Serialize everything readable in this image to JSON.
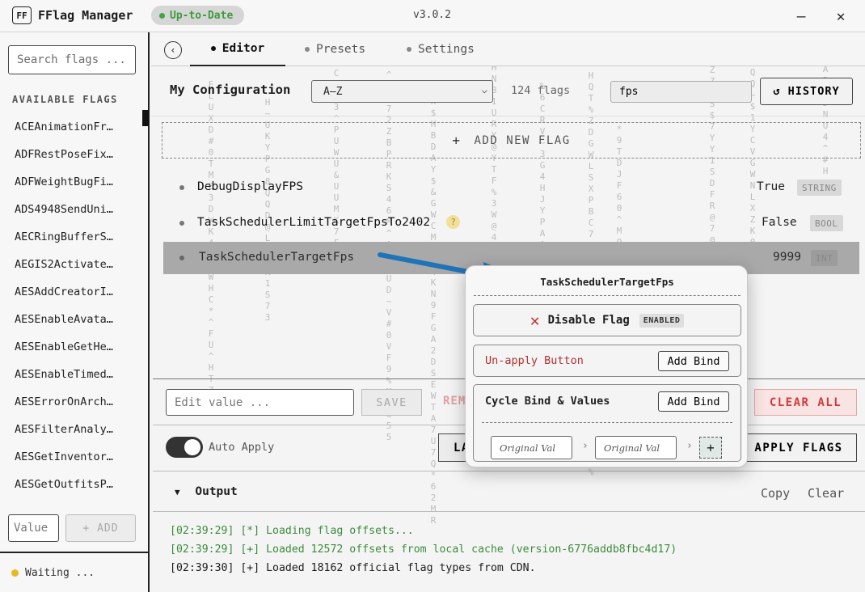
{
  "app": {
    "logo": "FF",
    "title": "FFlag Manager",
    "status": "Up-to-Date",
    "version": "v3.0.2",
    "minimize": "—",
    "close": "✕"
  },
  "sidebar": {
    "search_placeholder": "Search flags ...",
    "heading": "AVAILABLE FLAGS",
    "items": [
      "ACEAnimationFr…",
      "ADFRestPoseFix…",
      "ADFWeightBugFi…",
      "ADS4948SendUni…",
      "AECRingBufferS…",
      "AEGIS2Activate…",
      "AESAddCreatorI…",
      "AESEnableAvata…",
      "AESEnableGetHe…",
      "AESEnableTimed…",
      "AESErrorOnArch…",
      "AESFilterAnaly…",
      "AESGetInventor…",
      "AESGetOutfitsP…"
    ],
    "value_placeholder": "Value",
    "add_label": "+ ADD",
    "status": "Waiting ..."
  },
  "tabs": [
    {
      "label": "Editor",
      "active": true
    },
    {
      "label": "Presets",
      "active": false
    },
    {
      "label": "Settings",
      "active": false
    }
  ],
  "config": {
    "title": "My Configuration",
    "sort": "A–Z",
    "count": "124 flags",
    "filter": "fps",
    "history_label": "↺ HISTORY",
    "add_new_label": "ADD NEW FLAG",
    "add_new_plus": "+"
  },
  "flags": [
    {
      "name": "DebugDisplayFPS",
      "value": "True",
      "type": "STRING"
    },
    {
      "name": "TaskSchedulerLimitTargetFpsTo2402",
      "value": "False",
      "type": "BOOL",
      "help": "?"
    },
    {
      "name": "TaskSchedulerTargetFps",
      "value": "9999",
      "type": "INT"
    }
  ],
  "editor": {
    "value_placeholder": "Edit value ...",
    "save_label": "SAVE",
    "remove_label": "REM",
    "clear_all_label": "CLEAR ALL",
    "auto_apply_label": "Auto Apply",
    "auto_apply_on": true,
    "launch_label": "LA",
    "apply_label": "APPLY FLAGS"
  },
  "output": {
    "title": "Output",
    "copy_label": "Copy",
    "clear_label": "Clear",
    "lines": [
      {
        "text": "[02:39:29] [*] Loading flag offsets...",
        "color": "green"
      },
      {
        "text": "[02:39:29] [+] Loaded 12572 offsets from local cache (version-6776addb8fbc4d17)",
        "color": "green"
      },
      {
        "text": "[02:39:30] [+] Loaded 18162 official flag types from CDN.",
        "color": "black"
      }
    ]
  },
  "popup": {
    "title": "TaskSchedulerTargetFps",
    "disable_label": "Disable Flag",
    "disable_badge": "ENABLED",
    "unapply_label": "Un-apply Button",
    "add_bind_label": "Add Bind",
    "cycle_label": "Cycle Bind & Values",
    "cycle_add_bind_label": "Add Bind",
    "original_val_placeholder": "Original Val",
    "plus": "+"
  },
  "colors": {
    "accent_green": "#3d9a3d",
    "danger_red": "#c43333",
    "arrow_blue": "#1f74b8",
    "waiting_yellow": "#e8b923"
  }
}
